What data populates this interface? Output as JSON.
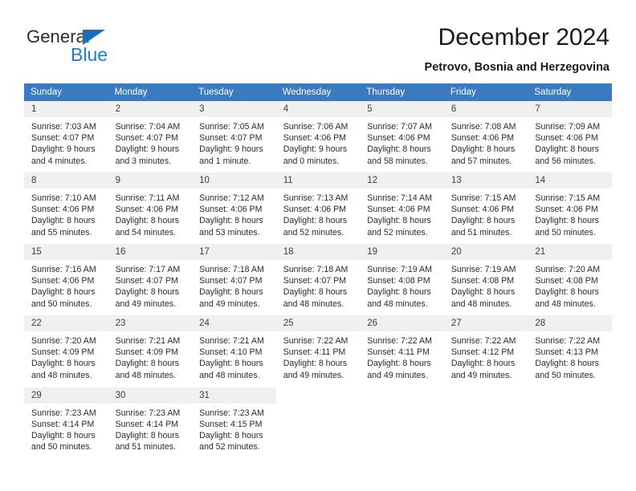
{
  "brand": {
    "name_part1": "General",
    "name_part2": "Blue",
    "accent_color": "#1a7fd4"
  },
  "header": {
    "title": "December 2024",
    "subtitle": "Petrovo, Bosnia and Herzegovina"
  },
  "calendar": {
    "header_color": "#3a7ac0",
    "weekdays": [
      "Sunday",
      "Monday",
      "Tuesday",
      "Wednesday",
      "Thursday",
      "Friday",
      "Saturday"
    ],
    "weeks": [
      [
        {
          "day": "1",
          "sunrise": "Sunrise: 7:03 AM",
          "sunset": "Sunset: 4:07 PM",
          "daylight_line1": "Daylight: 9 hours",
          "daylight_line2": "and 4 minutes."
        },
        {
          "day": "2",
          "sunrise": "Sunrise: 7:04 AM",
          "sunset": "Sunset: 4:07 PM",
          "daylight_line1": "Daylight: 9 hours",
          "daylight_line2": "and 3 minutes."
        },
        {
          "day": "3",
          "sunrise": "Sunrise: 7:05 AM",
          "sunset": "Sunset: 4:07 PM",
          "daylight_line1": "Daylight: 9 hours",
          "daylight_line2": "and 1 minute."
        },
        {
          "day": "4",
          "sunrise": "Sunrise: 7:06 AM",
          "sunset": "Sunset: 4:06 PM",
          "daylight_line1": "Daylight: 9 hours",
          "daylight_line2": "and 0 minutes."
        },
        {
          "day": "5",
          "sunrise": "Sunrise: 7:07 AM",
          "sunset": "Sunset: 4:06 PM",
          "daylight_line1": "Daylight: 8 hours",
          "daylight_line2": "and 58 minutes."
        },
        {
          "day": "6",
          "sunrise": "Sunrise: 7:08 AM",
          "sunset": "Sunset: 4:06 PM",
          "daylight_line1": "Daylight: 8 hours",
          "daylight_line2": "and 57 minutes."
        },
        {
          "day": "7",
          "sunrise": "Sunrise: 7:09 AM",
          "sunset": "Sunset: 4:06 PM",
          "daylight_line1": "Daylight: 8 hours",
          "daylight_line2": "and 56 minutes."
        }
      ],
      [
        {
          "day": "8",
          "sunrise": "Sunrise: 7:10 AM",
          "sunset": "Sunset: 4:06 PM",
          "daylight_line1": "Daylight: 8 hours",
          "daylight_line2": "and 55 minutes."
        },
        {
          "day": "9",
          "sunrise": "Sunrise: 7:11 AM",
          "sunset": "Sunset: 4:06 PM",
          "daylight_line1": "Daylight: 8 hours",
          "daylight_line2": "and 54 minutes."
        },
        {
          "day": "10",
          "sunrise": "Sunrise: 7:12 AM",
          "sunset": "Sunset: 4:06 PM",
          "daylight_line1": "Daylight: 8 hours",
          "daylight_line2": "and 53 minutes."
        },
        {
          "day": "11",
          "sunrise": "Sunrise: 7:13 AM",
          "sunset": "Sunset: 4:06 PM",
          "daylight_line1": "Daylight: 8 hours",
          "daylight_line2": "and 52 minutes."
        },
        {
          "day": "12",
          "sunrise": "Sunrise: 7:14 AM",
          "sunset": "Sunset: 4:06 PM",
          "daylight_line1": "Daylight: 8 hours",
          "daylight_line2": "and 52 minutes."
        },
        {
          "day": "13",
          "sunrise": "Sunrise: 7:15 AM",
          "sunset": "Sunset: 4:06 PM",
          "daylight_line1": "Daylight: 8 hours",
          "daylight_line2": "and 51 minutes."
        },
        {
          "day": "14",
          "sunrise": "Sunrise: 7:15 AM",
          "sunset": "Sunset: 4:06 PM",
          "daylight_line1": "Daylight: 8 hours",
          "daylight_line2": "and 50 minutes."
        }
      ],
      [
        {
          "day": "15",
          "sunrise": "Sunrise: 7:16 AM",
          "sunset": "Sunset: 4:06 PM",
          "daylight_line1": "Daylight: 8 hours",
          "daylight_line2": "and 50 minutes."
        },
        {
          "day": "16",
          "sunrise": "Sunrise: 7:17 AM",
          "sunset": "Sunset: 4:07 PM",
          "daylight_line1": "Daylight: 8 hours",
          "daylight_line2": "and 49 minutes."
        },
        {
          "day": "17",
          "sunrise": "Sunrise: 7:18 AM",
          "sunset": "Sunset: 4:07 PM",
          "daylight_line1": "Daylight: 8 hours",
          "daylight_line2": "and 49 minutes."
        },
        {
          "day": "18",
          "sunrise": "Sunrise: 7:18 AM",
          "sunset": "Sunset: 4:07 PM",
          "daylight_line1": "Daylight: 8 hours",
          "daylight_line2": "and 48 minutes."
        },
        {
          "day": "19",
          "sunrise": "Sunrise: 7:19 AM",
          "sunset": "Sunset: 4:08 PM",
          "daylight_line1": "Daylight: 8 hours",
          "daylight_line2": "and 48 minutes."
        },
        {
          "day": "20",
          "sunrise": "Sunrise: 7:19 AM",
          "sunset": "Sunset: 4:08 PM",
          "daylight_line1": "Daylight: 8 hours",
          "daylight_line2": "and 48 minutes."
        },
        {
          "day": "21",
          "sunrise": "Sunrise: 7:20 AM",
          "sunset": "Sunset: 4:08 PM",
          "daylight_line1": "Daylight: 8 hours",
          "daylight_line2": "and 48 minutes."
        }
      ],
      [
        {
          "day": "22",
          "sunrise": "Sunrise: 7:20 AM",
          "sunset": "Sunset: 4:09 PM",
          "daylight_line1": "Daylight: 8 hours",
          "daylight_line2": "and 48 minutes."
        },
        {
          "day": "23",
          "sunrise": "Sunrise: 7:21 AM",
          "sunset": "Sunset: 4:09 PM",
          "daylight_line1": "Daylight: 8 hours",
          "daylight_line2": "and 48 minutes."
        },
        {
          "day": "24",
          "sunrise": "Sunrise: 7:21 AM",
          "sunset": "Sunset: 4:10 PM",
          "daylight_line1": "Daylight: 8 hours",
          "daylight_line2": "and 48 minutes."
        },
        {
          "day": "25",
          "sunrise": "Sunrise: 7:22 AM",
          "sunset": "Sunset: 4:11 PM",
          "daylight_line1": "Daylight: 8 hours",
          "daylight_line2": "and 49 minutes."
        },
        {
          "day": "26",
          "sunrise": "Sunrise: 7:22 AM",
          "sunset": "Sunset: 4:11 PM",
          "daylight_line1": "Daylight: 8 hours",
          "daylight_line2": "and 49 minutes."
        },
        {
          "day": "27",
          "sunrise": "Sunrise: 7:22 AM",
          "sunset": "Sunset: 4:12 PM",
          "daylight_line1": "Daylight: 8 hours",
          "daylight_line2": "and 49 minutes."
        },
        {
          "day": "28",
          "sunrise": "Sunrise: 7:22 AM",
          "sunset": "Sunset: 4:13 PM",
          "daylight_line1": "Daylight: 8 hours",
          "daylight_line2": "and 50 minutes."
        }
      ],
      [
        {
          "day": "29",
          "sunrise": "Sunrise: 7:23 AM",
          "sunset": "Sunset: 4:14 PM",
          "daylight_line1": "Daylight: 8 hours",
          "daylight_line2": "and 50 minutes."
        },
        {
          "day": "30",
          "sunrise": "Sunrise: 7:23 AM",
          "sunset": "Sunset: 4:14 PM",
          "daylight_line1": "Daylight: 8 hours",
          "daylight_line2": "and 51 minutes."
        },
        {
          "day": "31",
          "sunrise": "Sunrise: 7:23 AM",
          "sunset": "Sunset: 4:15 PM",
          "daylight_line1": "Daylight: 8 hours",
          "daylight_line2": "and 52 minutes."
        },
        {
          "day": "",
          "sunrise": "",
          "sunset": "",
          "daylight_line1": "",
          "daylight_line2": ""
        },
        {
          "day": "",
          "sunrise": "",
          "sunset": "",
          "daylight_line1": "",
          "daylight_line2": ""
        },
        {
          "day": "",
          "sunrise": "",
          "sunset": "",
          "daylight_line1": "",
          "daylight_line2": ""
        },
        {
          "day": "",
          "sunrise": "",
          "sunset": "",
          "daylight_line1": "",
          "daylight_line2": ""
        }
      ]
    ]
  }
}
